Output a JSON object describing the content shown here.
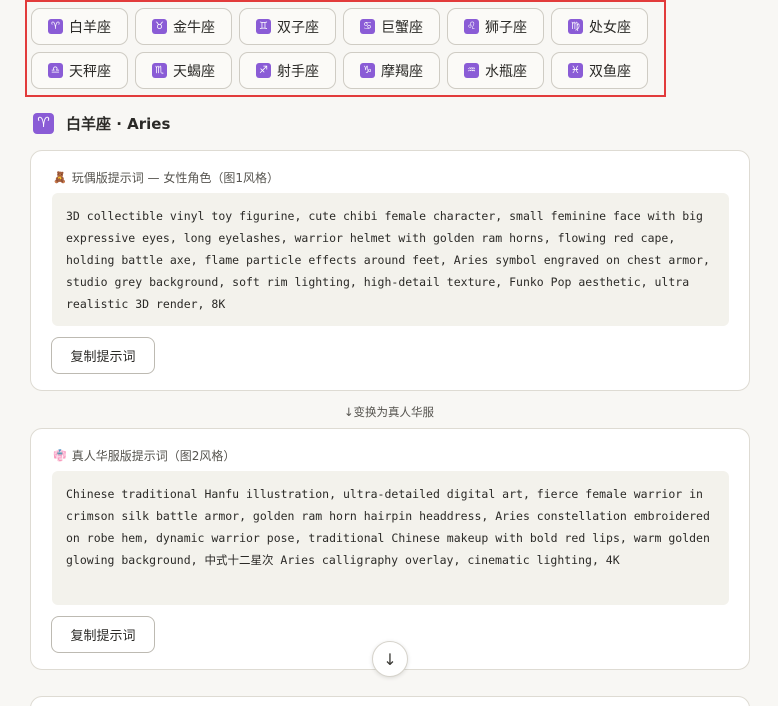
{
  "zodiac_rows": [
    [
      {
        "symbol": "♈",
        "label": "白羊座"
      },
      {
        "symbol": "♉",
        "label": "金牛座"
      },
      {
        "symbol": "♊",
        "label": "双子座"
      },
      {
        "symbol": "♋",
        "label": "巨蟹座"
      },
      {
        "symbol": "♌",
        "label": "狮子座"
      },
      {
        "symbol": "♍",
        "label": "处女座"
      }
    ],
    [
      {
        "symbol": "♎",
        "label": "天秤座"
      },
      {
        "symbol": "♏",
        "label": "天蝎座"
      },
      {
        "symbol": "♐",
        "label": "射手座"
      },
      {
        "symbol": "♑",
        "label": "摩羯座"
      },
      {
        "symbol": "♒",
        "label": "水瓶座"
      },
      {
        "symbol": "♓",
        "label": "双鱼座"
      }
    ]
  ],
  "heading": {
    "symbol": "♈",
    "title": "白羊座 · Aries"
  },
  "card1": {
    "icon": "🧸",
    "title": "玩偶版提示词 — 女性角色（图1风格）",
    "prompt": "3D collectible vinyl toy figurine, cute chibi female character, small feminine face with big expressive eyes, long eyelashes, warrior helmet with golden ram horns, flowing red cape, holding battle axe, flame particle effects around feet, Aries symbol engraved on chest armor, studio grey background, soft rim lighting, high-detail texture, Funko Pop aesthetic, ultra realistic 3D render, 8K",
    "copy_label": "复制提示词"
  },
  "transform_label": "↓变换为真人华服",
  "card2": {
    "icon": "👘",
    "title": "真人华服版提示词（图2风格）",
    "prompt": "Chinese traditional Hanfu illustration, ultra-detailed digital art, fierce female warrior in crimson silk battle armor, golden ram horn hairpin headdress, Aries constellation embroidered on robe hem, dynamic warrior pose, traditional Chinese makeup with bold red lips, warm golden glowing background, 中式十二星次 Aries calligraphy overlay, cinematic lighting, 4K",
    "copy_label": "复制提示词"
  },
  "scroll_down": "↓",
  "colors": {
    "accent": "#8a5cd6",
    "highlight_border": "#e23b3b"
  }
}
